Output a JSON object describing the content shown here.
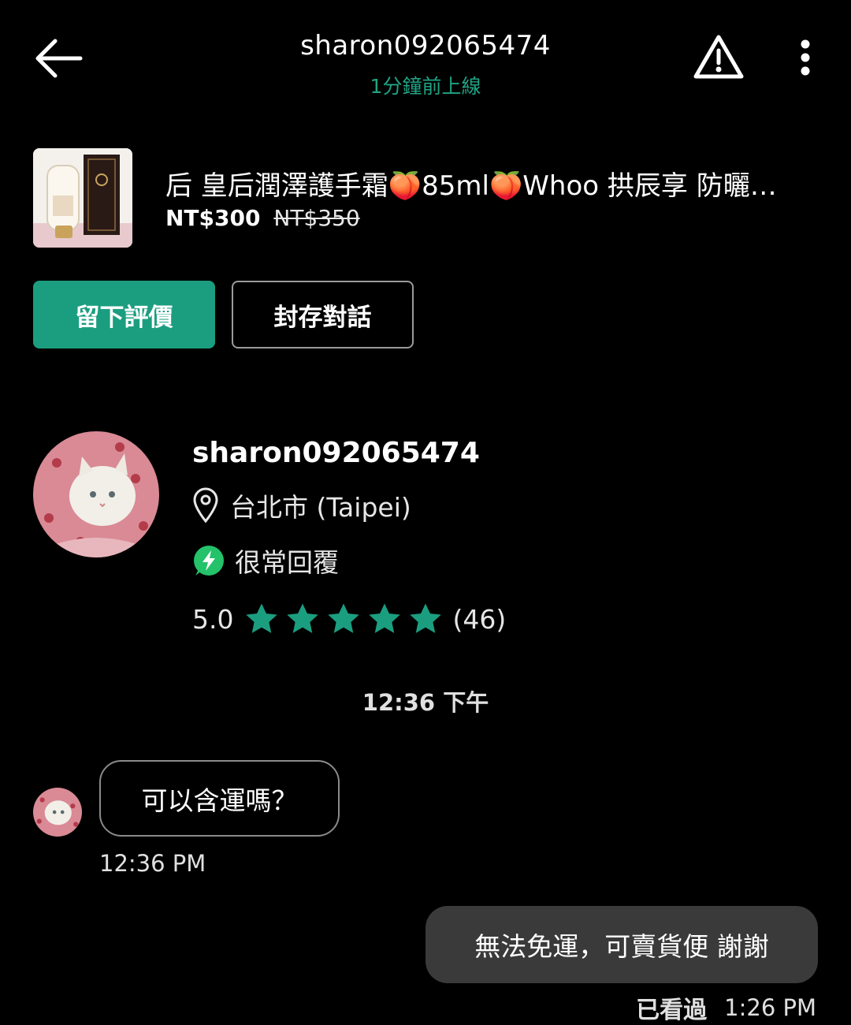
{
  "header": {
    "title": "sharon092065474",
    "status": "1分鐘前上線"
  },
  "product": {
    "title": "后 皇后潤澤護手霜🍑85ml🍑Whoo 拱辰享 防曬…",
    "price_now": "NT$300",
    "price_old": "NT$350"
  },
  "actions": {
    "review_label": "留下評價",
    "archive_label": "封存對話"
  },
  "seller": {
    "name": "sharon092065474",
    "location": "台北市 (Taipei)",
    "reply_badge": "很常回覆",
    "rating": "5.0",
    "stars": 5,
    "review_count": "(46)"
  },
  "chat": {
    "day_stamp": "12:36 下午",
    "messages": [
      {
        "direction": "in",
        "text": "可以含運嗎？",
        "time": "12:36 PM"
      },
      {
        "direction": "out",
        "text": "無法免運，可賣貨便 謝謝",
        "seen_label": "已看過",
        "time": "1:26 PM"
      }
    ]
  },
  "colors": {
    "accent": "#1b9e80",
    "status_green": "#1fa384",
    "badge_green": "#24c26a",
    "outgoing_bubble": "#3a3a3a"
  },
  "icons": [
    "back-arrow-icon",
    "warning-icon",
    "more-vert-icon",
    "location-pin-icon",
    "lightning-icon",
    "star-icon"
  ]
}
